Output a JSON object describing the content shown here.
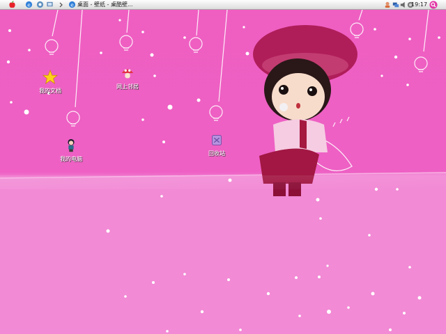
{
  "taskbar": {
    "start_icon": "apple-logo-icon",
    "quick_launch": [
      "ie-icon",
      "explorer-icon",
      "desktop-icon"
    ],
    "active_task": {
      "icon": "ie-icon",
      "title": "桌面 - 壁纸 - 桌酷壁..."
    },
    "tray_icons": [
      "user-icon",
      "network-icon",
      "volume-icon",
      "security-icon"
    ],
    "clock": "19:17",
    "search_icon": "search-icon"
  },
  "desktop": {
    "icons": [
      {
        "name": "my-documents",
        "label": "我的文档",
        "icon": "star-icon"
      },
      {
        "name": "online-neighbors",
        "label": "网上邻居",
        "icon": "mushroom-icon"
      },
      {
        "name": "my-computer",
        "label": "我的电脑",
        "icon": "girl-icon"
      },
      {
        "name": "recycle-bin",
        "label": "回收站",
        "icon": "recycle-bin-icon"
      }
    ],
    "wallpaper": "pink-doll-wallpaper",
    "colors": {
      "wallpaper_top": "#ee60c4",
      "wallpaper_bottom": "#f389d6",
      "accent": "#b2185e"
    }
  }
}
